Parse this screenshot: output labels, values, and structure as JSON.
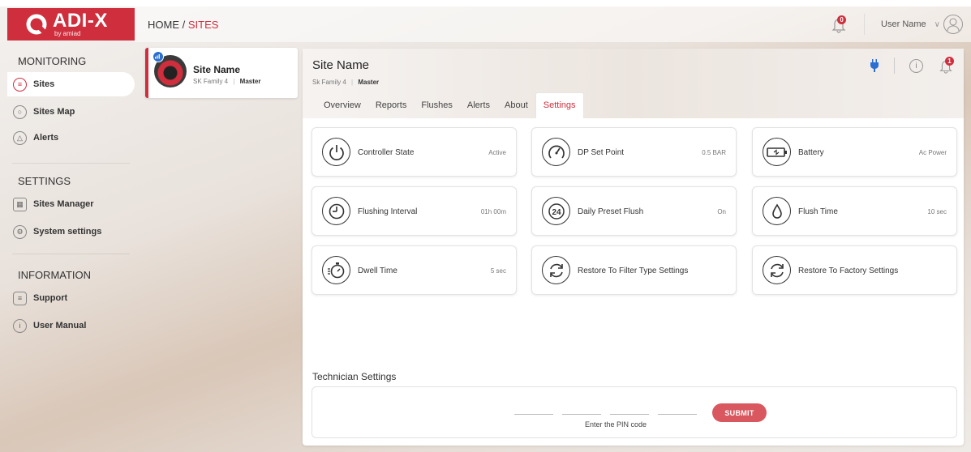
{
  "app": {
    "logo_text": "ADI-X",
    "logo_subtext": "by amiad"
  },
  "header": {
    "breadcrumb_home": "HOME /",
    "breadcrumb_current": "SITES",
    "user_name": "User Name",
    "notification_count": "0"
  },
  "sidebar": {
    "sections": [
      {
        "title": "MONITORING",
        "items": [
          {
            "label": "Sites"
          },
          {
            "label": "Sites Map"
          },
          {
            "label": "Alerts"
          }
        ]
      },
      {
        "title": "SETTINGS",
        "items": [
          {
            "label": "Sites Manager"
          },
          {
            "label": "System settings"
          }
        ]
      },
      {
        "title": "INFORMATION",
        "items": [
          {
            "label": "Support"
          },
          {
            "label": "User Manual"
          }
        ]
      }
    ]
  },
  "site_card": {
    "name": "Site Name",
    "family": "SK Family 4",
    "role": "Master"
  },
  "main": {
    "title": "Site Name",
    "family": "Sk Family 4",
    "role": "Master",
    "alert_count": "1",
    "tabs": [
      {
        "label": "Overview"
      },
      {
        "label": "Reports"
      },
      {
        "label": "Flushes"
      },
      {
        "label": "Alerts"
      },
      {
        "label": "About"
      },
      {
        "label": "Settings"
      }
    ],
    "active_tab": "Settings"
  },
  "settings_cards": [
    {
      "label": "Controller State",
      "value": "Active",
      "icon": "power-icon"
    },
    {
      "label": "DP Set Point",
      "value": "0.5 BAR",
      "icon": "gauge-icon"
    },
    {
      "label": "Battery",
      "value": "Ac Power",
      "icon": "battery-icon"
    },
    {
      "label": "Flushing Interval",
      "value": "01h 00m",
      "icon": "clock-icon"
    },
    {
      "label": "Daily Preset Flush",
      "value": "On",
      "icon": "24h-icon"
    },
    {
      "label": "Flush Time",
      "value": "10 sec",
      "icon": "water-drop-icon"
    },
    {
      "label": "Dwell Time",
      "value": "5 sec",
      "icon": "stopwatch-icon"
    },
    {
      "label": "Restore To Filter Type Settings",
      "value": "",
      "icon": "restore-icon"
    },
    {
      "label": "Restore To Factory Settings",
      "value": "",
      "icon": "restore-icon"
    }
  ],
  "technician": {
    "title": "Technician Settings",
    "pin_hint": "Enter the PIN code",
    "submit_label": "SUBMIT"
  },
  "colors": {
    "accent": "#cf2e3d",
    "submit": "#d9575f"
  }
}
